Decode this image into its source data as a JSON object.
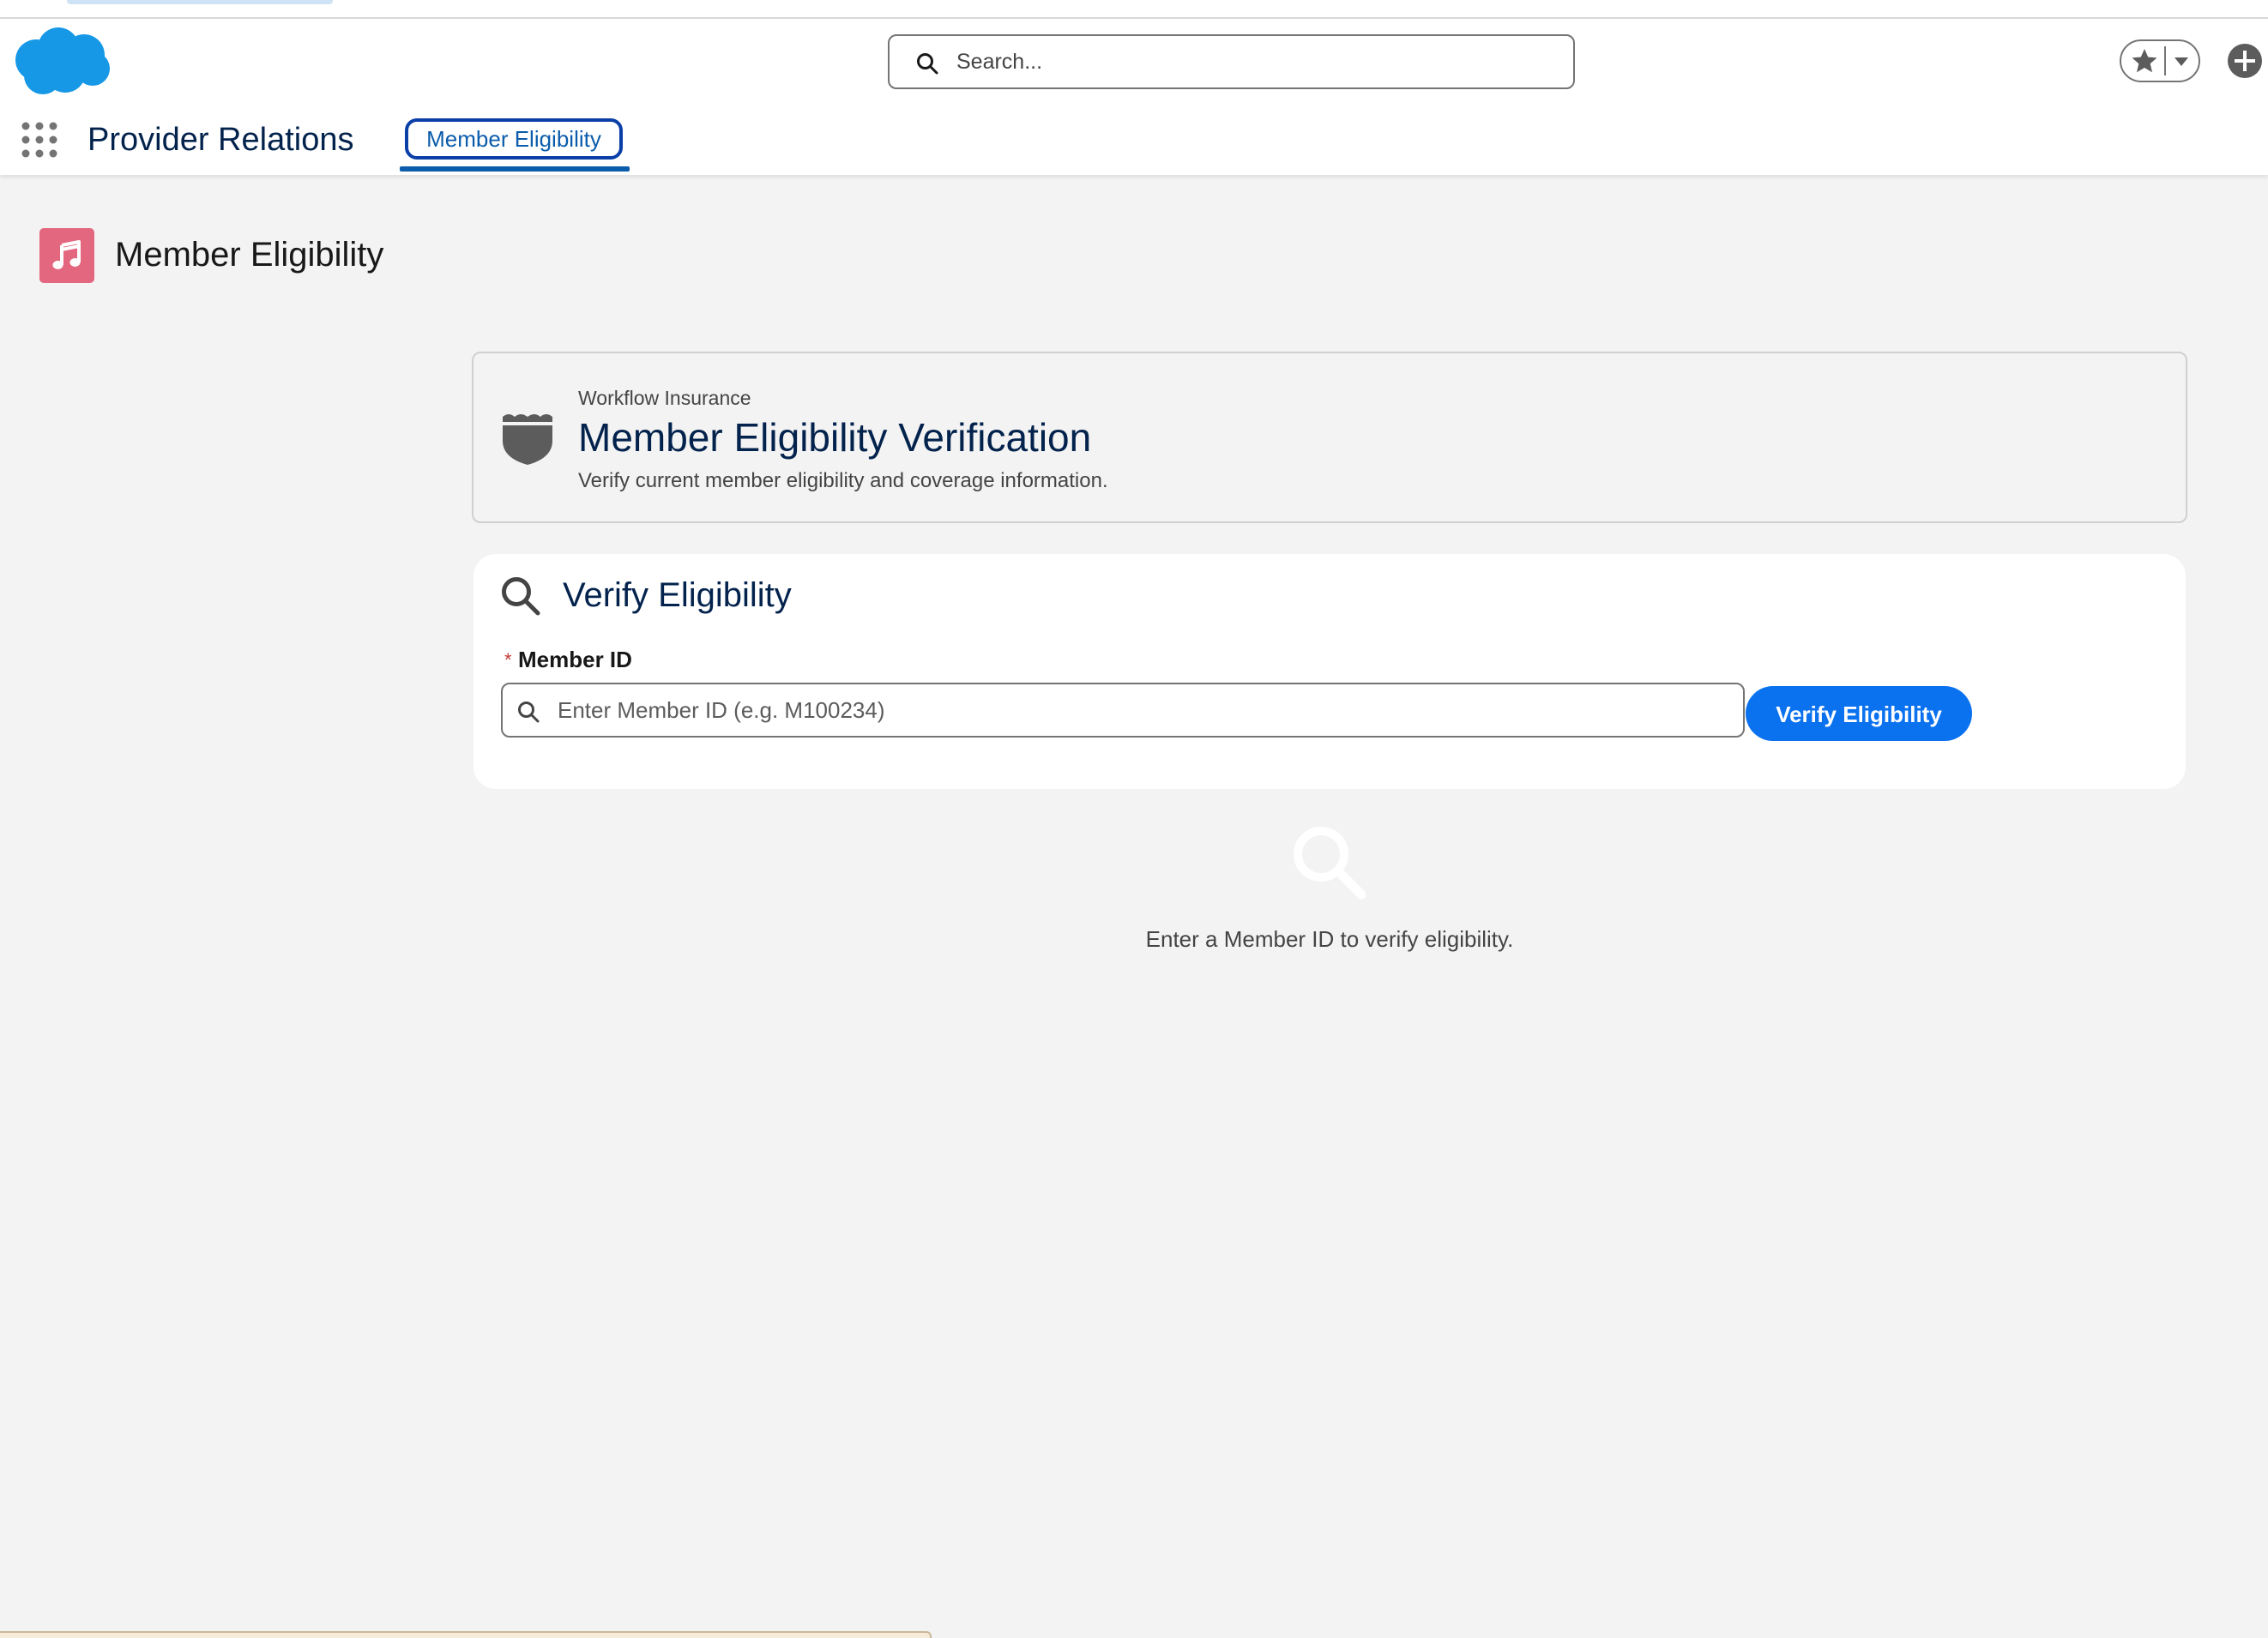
{
  "colors": {
    "brand_cloud": "#1798e6",
    "navy": "#03234d",
    "primary_button": "#0b72ef",
    "page_icon": "#e3687f",
    "required": "#c23934"
  },
  "header": {
    "logo_icon": "salesforce-cloud-logo",
    "search": {
      "placeholder": "Search..."
    },
    "favorites_icon": "star-icon",
    "favorites_menu_icon": "caret-down-icon",
    "global_actions_icon": "plus-circle-icon"
  },
  "nav": {
    "app_launcher_icon": "waffle-grid-icon",
    "app_name": "Provider Relations",
    "tabs": [
      {
        "label": "Member Eligibility",
        "active": true
      }
    ]
  },
  "page": {
    "icon": "music-note-icon",
    "title": "Member Eligibility"
  },
  "hero": {
    "icon": "shield-icon",
    "eyebrow": "Workflow Insurance",
    "title": "Member Eligibility Verification",
    "subtitle": "Verify current member eligibility and coverage information."
  },
  "verify": {
    "icon": "search-icon",
    "title": "Verify Eligibility",
    "required_marker": "*",
    "field_label": "Member ID",
    "input_placeholder": "Enter Member ID (e.g. M100234)",
    "input_value": "",
    "button_label": "Verify Eligibility"
  },
  "empty_state": {
    "icon": "search-icon",
    "message": "Enter a Member ID to verify eligibility."
  }
}
